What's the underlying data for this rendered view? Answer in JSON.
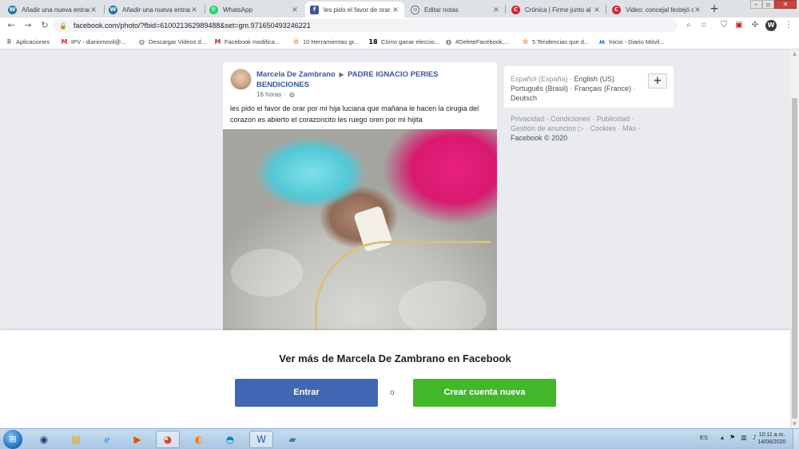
{
  "browser": {
    "tabs": [
      {
        "label": "Añadir una nueva entrada",
        "icon": "wordpress-icon",
        "active": false
      },
      {
        "label": "Añadir una nueva entrada",
        "icon": "wordpress-icon",
        "active": false
      },
      {
        "label": "WhatsApp",
        "icon": "whatsapp-icon",
        "active": false
      },
      {
        "label": "les pido el favor de orar p",
        "icon": "facebook-icon",
        "active": true
      },
      {
        "label": "Editar notas",
        "icon": "globe-icon",
        "active": false
      },
      {
        "label": "Crónica | Firme junto al p",
        "icon": "cronica-icon",
        "active": false
      },
      {
        "label": "Video: concejal festejó su",
        "icon": "cronica-icon",
        "active": false
      }
    ],
    "url": "facebook.com/photo/?fbid=610021362989488&set=gm.971650493246221",
    "bookmarks": [
      {
        "label": "Aplicaciones",
        "icon": "apps-grid-icon"
      },
      {
        "label": "IPV - diariomovil@...",
        "icon": "gmail-icon"
      },
      {
        "label": "Descargar Videos d...",
        "icon": "globe-icon"
      },
      {
        "label": "Facebook modifica...",
        "icon": "m-logo-icon"
      },
      {
        "label": "10 Herramientas gr...",
        "icon": "hubspot-icon"
      },
      {
        "label": "Cómo ganar eleccio...",
        "icon": "eighteen-logo-icon"
      },
      {
        "label": "#DeleteFacebook,...",
        "icon": "globe-icon"
      },
      {
        "label": "5 Tendencias que d...",
        "icon": "hubspot-icon"
      },
      {
        "label": "Inicio - Diario Móvil...",
        "icon": "diario-movil-icon"
      }
    ]
  },
  "post": {
    "author": "Marcela De Zambrano",
    "group": "PADRE IGNACIO PERIES BENDICIONES",
    "time": "16 horas",
    "separator": "·",
    "text": "les pido el favor de orar por mi hija luciana que mañana le hacen la cirugia del corazon es abierto el corazoncito les ruego oren por mi hijita"
  },
  "sidebar": {
    "languages": [
      {
        "label": "Español (España)",
        "current": true
      },
      {
        "label": "English (US)",
        "current": false
      },
      {
        "label": "Português (Brasil)",
        "current": false
      },
      {
        "label": "Français (France)",
        "current": false
      },
      {
        "label": "Deutsch",
        "current": false
      }
    ],
    "plus_label": "+",
    "footer": [
      "Privacidad",
      "Condiciones",
      "Publicidad",
      "Gestión de anuncios",
      "Cookies",
      "Más"
    ],
    "copyright": "Facebook © 2020"
  },
  "overlay": {
    "title": "Ver más de Marcela De Zambrano en Facebook",
    "login_label": "Entrar",
    "or_label": "o",
    "signup_label": "Crear cuenta nueva"
  },
  "taskbar": {
    "language": "ES",
    "time": "10:11 a.m.",
    "date": "14/08/2020"
  },
  "colors": {
    "facebook_blue": "#4267b2",
    "link_blue": "#385898",
    "signup_green": "#42b72a",
    "page_bg": "#e9ebee"
  }
}
